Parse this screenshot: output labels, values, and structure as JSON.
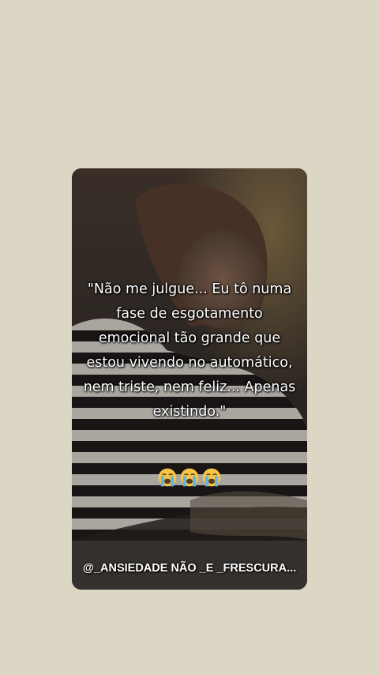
{
  "story": {
    "quote": "\"Não me julgue... Eu tô numa\nfase de esgotamento\nemocional tão grande que\nestou vivendo no automático,\nnem triste, nem feliz... Apenas\nexistindo.\"",
    "emojis": [
      "loudly-crying-face",
      "loudly-crying-face",
      "loudly-crying-face"
    ],
    "watermark": "@_ANSIEDADE NÃO _E _FRESCURA..."
  },
  "colors": {
    "page_background": "#dcd7c5",
    "text": "#ffffff",
    "emoji_face": "#f6c544",
    "emoji_tears": "#5fb6e6"
  }
}
